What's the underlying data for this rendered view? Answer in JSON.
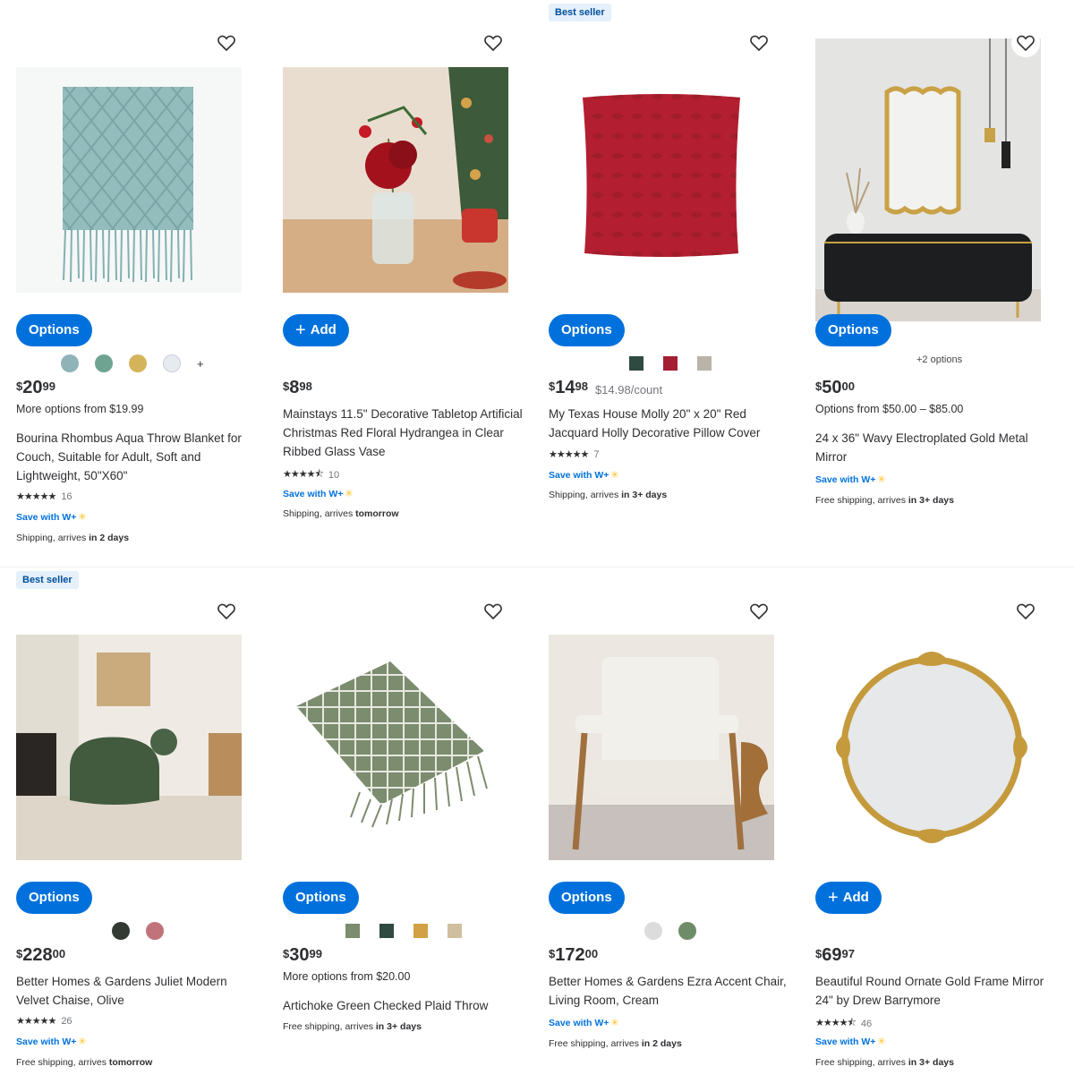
{
  "colors": {
    "accent": "#0071dc",
    "badge_bg": "#e5f0fa",
    "badge_text": "#004f9a",
    "w_plus_spark": "#ffc220"
  },
  "products": [
    {
      "badge": "",
      "button": "Options",
      "button_icon": "",
      "swatch_colors": [
        "#8fb3b8",
        "#6ea392",
        "#d4b45a",
        "#e5ebee"
      ],
      "more_swatches": "+",
      "options_count": "",
      "price_currency": "$",
      "price_dollars": "20",
      "price_cents": "99",
      "unit_price": "",
      "from_line": "More options from $19.99",
      "title": "Bourina Rhombus Aqua Throw Blanket for Couch, Suitable for Adult, Soft and Lightweight, 50\"X60\"",
      "stars": "★★★★★",
      "rating_value": 5.0,
      "review_count": "16",
      "save_with": "Save with W+",
      "ship_prefix": "Shipping, arrives ",
      "ship_bold": "in 2 days"
    },
    {
      "badge": "",
      "button": "Add",
      "button_icon": "+",
      "swatch_colors": [],
      "more_swatches": "",
      "options_count": "",
      "price_currency": "$",
      "price_dollars": "8",
      "price_cents": "98",
      "unit_price": "",
      "from_line": "",
      "title": "Mainstays 11.5\" Decorative Tabletop Artificial Christmas Red Floral Hydrangea in Clear Ribbed Glass Vase",
      "stars": "★★★★⯪",
      "rating_value": 4.5,
      "review_count": "10",
      "save_with": "Save with W+",
      "ship_prefix": "Shipping, arrives ",
      "ship_bold": "tomorrow"
    },
    {
      "badge": "Best seller",
      "button": "Options",
      "button_icon": "",
      "swatch_colors": [
        "#2f4a40",
        "#a41e34",
        "#b9b3a8"
      ],
      "more_swatches": "",
      "options_count": "",
      "price_currency": "$",
      "price_dollars": "14",
      "price_cents": "98",
      "unit_price": "$14.98/count",
      "from_line": "",
      "title": "My Texas House Molly 20\" x 20\" Red Jacquard Holly Decorative Pillow Cover",
      "stars": "★★★★★",
      "rating_value": 5.0,
      "review_count": "7",
      "save_with": "Save with W+",
      "ship_prefix": "Shipping, arrives ",
      "ship_bold": "in 3+ days"
    },
    {
      "badge": "",
      "button": "Options",
      "button_icon": "",
      "swatch_colors": [],
      "more_swatches": "",
      "options_count": "+2 options",
      "price_currency": "$",
      "price_dollars": "50",
      "price_cents": "00",
      "unit_price": "",
      "from_line": "Options from $50.00 – $85.00",
      "title": "24 x 36\" Wavy Electroplated Gold Metal Mirror",
      "stars": "",
      "rating_value": null,
      "review_count": "",
      "save_with": "Save with W+",
      "ship_prefix": "Free shipping, arrives ",
      "ship_bold": "in 3+ days"
    },
    {
      "badge": "Best seller",
      "button": "Options",
      "button_icon": "",
      "swatch_colors": [
        "#333a33",
        "#c0737a"
      ],
      "more_swatches": "",
      "options_count": "",
      "price_currency": "$",
      "price_dollars": "228",
      "price_cents": "00",
      "unit_price": "",
      "from_line": "",
      "title": "Better Homes & Gardens Juliet Modern Velvet Chaise, Olive",
      "stars": "★★★★★",
      "rating_value": 5.0,
      "review_count": "26",
      "save_with": "Save with W+",
      "ship_prefix": "Free shipping, arrives ",
      "ship_bold": "tomorrow"
    },
    {
      "badge": "",
      "button": "Options",
      "button_icon": "",
      "swatch_colors": [
        "#7c8c6e",
        "#2f4a40",
        "#d2a145",
        "#cfbf9f"
      ],
      "more_swatches": "",
      "options_count": "",
      "price_currency": "$",
      "price_dollars": "30",
      "price_cents": "99",
      "unit_price": "",
      "from_line": "More options from $20.00",
      "title": "Artichoke Green Checked Plaid Throw",
      "stars": "",
      "rating_value": null,
      "review_count": "",
      "save_with": "",
      "ship_prefix": "Free shipping, arrives ",
      "ship_bold": "in 3+ days"
    },
    {
      "badge": "",
      "button": "Options",
      "button_icon": "",
      "swatch_colors": [
        "#dcdcdc",
        "#6f8c68"
      ],
      "more_swatches": "",
      "options_count": "",
      "price_currency": "$",
      "price_dollars": "172",
      "price_cents": "00",
      "unit_price": "",
      "from_line": "",
      "title": "Better Homes & Gardens Ezra Accent Chair, Living Room, Cream",
      "stars": "",
      "rating_value": null,
      "review_count": "",
      "save_with": "Save with W+",
      "ship_prefix": "Free shipping, arrives ",
      "ship_bold": "in 2 days"
    },
    {
      "badge": "",
      "button": "Add",
      "button_icon": "+",
      "swatch_colors": [],
      "more_swatches": "",
      "options_count": "",
      "price_currency": "$",
      "price_dollars": "69",
      "price_cents": "97",
      "unit_price": "",
      "from_line": "",
      "title": "Beautiful Round Ornate Gold Frame Mirror 24\" by Drew Barrymore",
      "stars": "★★★★⯪",
      "rating_value": 4.5,
      "review_count": "46",
      "save_with": "Save with W+",
      "ship_prefix": "Free shipping, arrives ",
      "ship_bold": "in 3+ days"
    }
  ]
}
